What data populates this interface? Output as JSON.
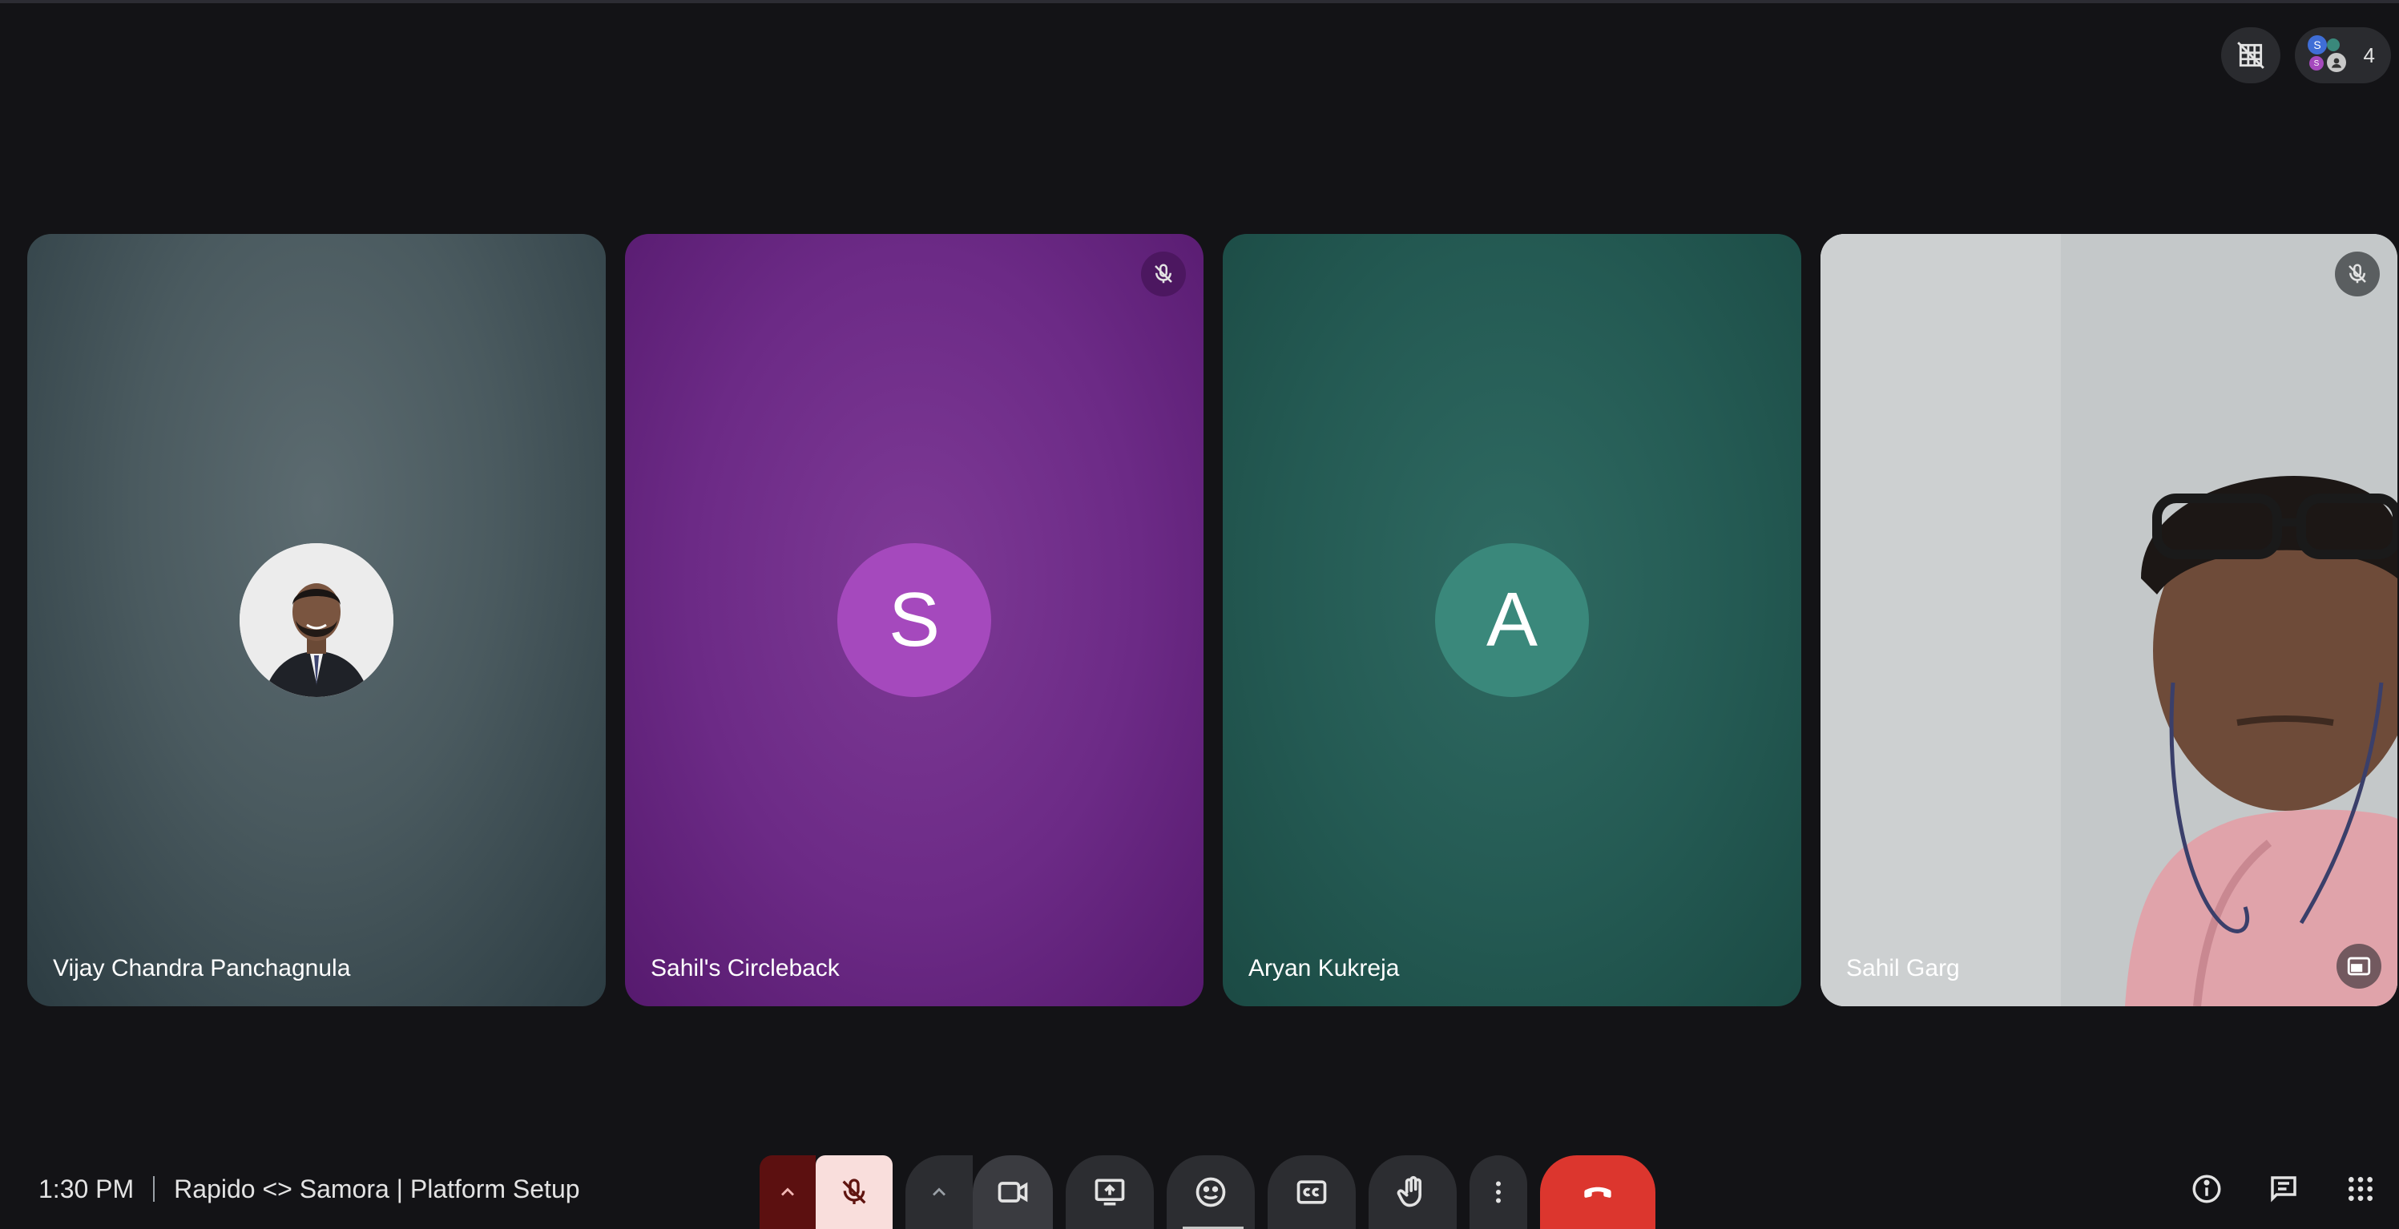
{
  "header": {
    "participant_count": "4",
    "mini_avatars": [
      "S",
      "S",
      "S"
    ]
  },
  "tiles": [
    {
      "name": "Vijay Chandra Panchagnula",
      "avatar": "photo",
      "muted": false
    },
    {
      "name": "Sahil's Circleback",
      "avatar_letter": "S",
      "muted": true
    },
    {
      "name": "Aryan Kukreja",
      "avatar_letter": "A",
      "muted": false
    },
    {
      "name": "Sahil Garg",
      "avatar": "video",
      "muted": true
    }
  ],
  "footer": {
    "time": "1:30 PM",
    "meeting_title": "Rapido <> Samora | Platform Setup"
  },
  "colors": {
    "background": "#131316",
    "end_call": "#dc362e",
    "mic_off_bg": "#f9dedc",
    "tile_purple": "#6c2a86",
    "tile_teal": "#245a53"
  }
}
